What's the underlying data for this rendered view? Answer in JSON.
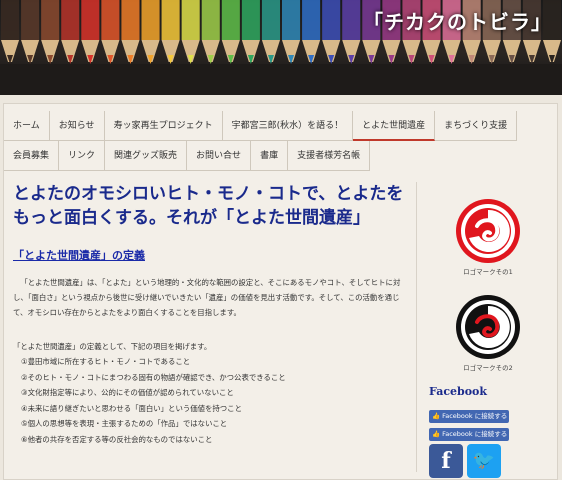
{
  "header": {
    "site_title": "「チカクのトビラ」"
  },
  "nav": {
    "items": [
      {
        "label": "ホーム",
        "active": false
      },
      {
        "label": "お知らせ",
        "active": false
      },
      {
        "label": "寿ッ家再生プロジェクト",
        "active": false
      },
      {
        "label": "宇都宮三郎(秋水）を語る！",
        "active": false
      },
      {
        "label": "とよた世間遺産",
        "active": true
      },
      {
        "label": "まちづくり支援",
        "active": false
      },
      {
        "label": "会員募集",
        "active": false
      },
      {
        "label": "リンク",
        "active": false
      },
      {
        "label": "関連グッズ販売",
        "active": false
      },
      {
        "label": "お問い合せ",
        "active": false
      },
      {
        "label": "書庫",
        "active": false
      },
      {
        "label": "支援者様芳名帳",
        "active": false
      }
    ]
  },
  "main": {
    "title": "とよたのオモシロいヒト・モノ・コトで、とよたをもっと面白くする。それが「とよた世間遺産」",
    "section_heading": "「とよた世間遺産」の定義",
    "paragraph": "「とよた世間遺産」は、「とよた」という地理的・文化的な範囲の設定と、そこにあるモノやコト、そしてヒトに対し、「面白さ」という視点から後世に受け継いでいきたい「遺産」の価値を見出す活動です。そして、この活動を通じて、オモシロい存在からとよたをより面白くすることを目指します。",
    "list_intro": "「とよた世間遺産」の定義として、下記の項目を掲げます。",
    "criteria": [
      "①豊田市域に所在するヒト・モノ・コトであること",
      "②そのヒト・モノ・コトにまつわる固有の物語が確認でき、かつ公表できること",
      "③文化財指定等により、公的にその価値が認められていないこと",
      "④未来に語り継ぎたいと思わせる「面白い」という価値を持つこと",
      "⑤個人の思想等を表現・主張するための「作品」ではないこと",
      "⑥他者の共存を否定する等の反社会的なものではないこと"
    ]
  },
  "sidebar": {
    "logo1_caption": "ロゴマークその1",
    "logo2_caption": "ロゴマークその2",
    "facebook_heading": "Facebook",
    "fb_button1": "Facebook に接続する",
    "fb_button2": "Facebook に接続する",
    "facebook_icon_glyph": "f",
    "twitter_icon_glyph": "🐦"
  },
  "colors": {
    "title_blue": "#1a2a8c",
    "logo_red": "#e0161e",
    "logo_black": "#111111",
    "facebook_blue": "#3b5998",
    "twitter_blue": "#1da1f2"
  }
}
